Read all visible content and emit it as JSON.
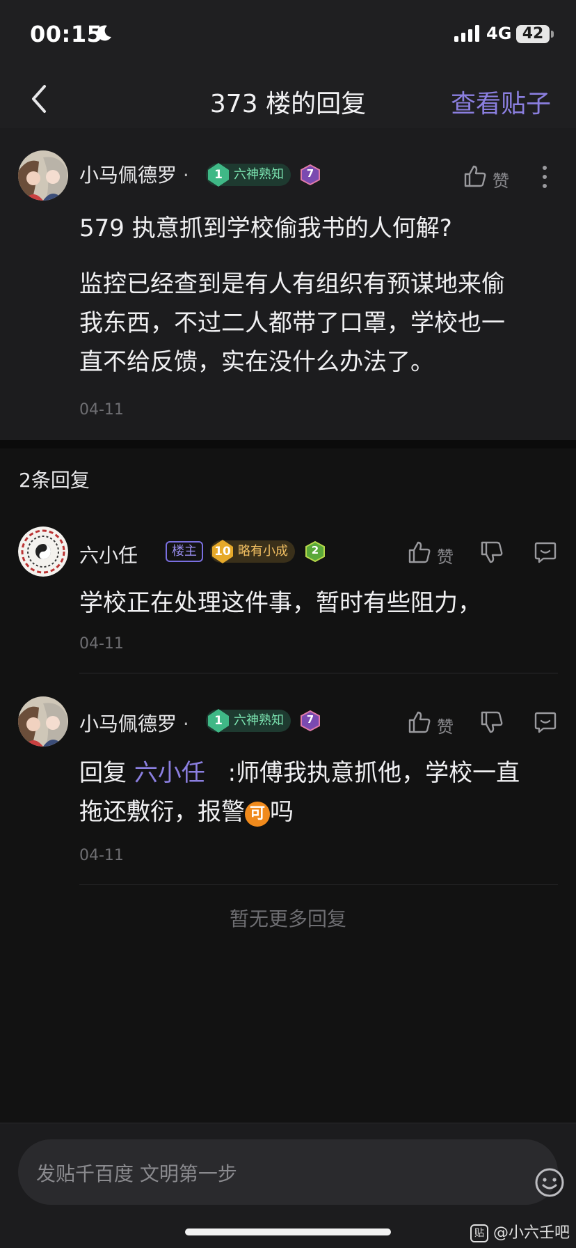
{
  "status_bar": {
    "time": "00:15",
    "network": "4G",
    "battery": "42"
  },
  "nav": {
    "title": "373 楼的回复",
    "link": "查看贴子"
  },
  "main_post": {
    "username": "小马佩德罗",
    "dot": "·",
    "level_num": "1",
    "level_title": "六神熟知",
    "badge_num": "7",
    "like_label": "赞",
    "title_line": "579 执意抓到学校偷我书的人何解?",
    "body_lines": [
      "监控已经查到是有人有组织有预谋地来偷",
      "我东西，不过二人都带了口罩，学校也一",
      "直不给反馈，实在没什么办法了。"
    ],
    "date": "04-11"
  },
  "reply_count": "2条回复",
  "replies": [
    {
      "username": "六小任",
      "host_tag": "楼主",
      "level_num": "10",
      "level_title": "略有小成",
      "badge_num": "2",
      "like_label": "赞",
      "text": "学校正在处理这件事，暂时有些阻力，",
      "date": "04-11"
    },
    {
      "username": "小马佩德罗",
      "dot": "·",
      "level_num": "1",
      "level_title": "六神熟知",
      "badge_num": "7",
      "like_label": "赞",
      "reply_prefix": "回复",
      "mention": "六小任",
      "line1_rest": ":师傅我执意抓他，学校一直",
      "line2_a": "拖还敷衍，报警",
      "emoji": "可",
      "line2_b": "吗",
      "date": "04-11"
    }
  ],
  "no_more": "暂无更多回复",
  "input": {
    "placeholder": "发贴千百度 文明第一步"
  },
  "watermark": {
    "icon": "贴",
    "text": "@小六壬吧"
  },
  "colors": {
    "accent": "#8b7fe0",
    "background": "#121212",
    "card": "#1c1c1e"
  }
}
